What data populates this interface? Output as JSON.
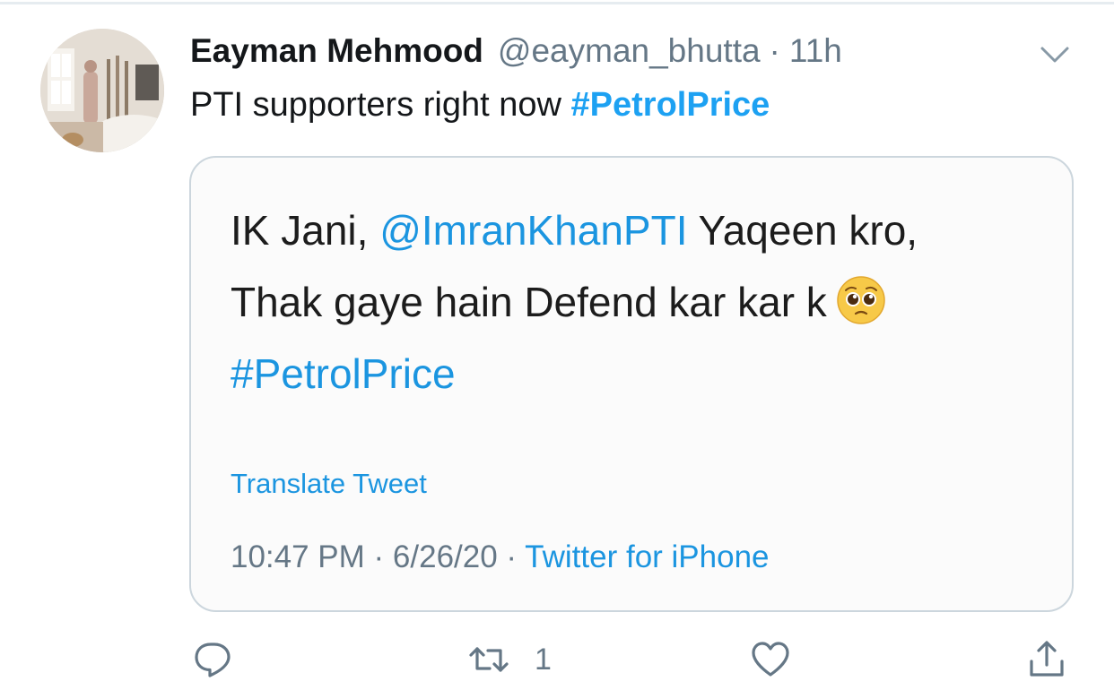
{
  "tweet": {
    "author_name": "Eayman Mehmood",
    "handle": "@eayman_bhutta",
    "separator": "·",
    "time": "11h",
    "text": "PTI supporters right now",
    "hashtag": "#PetrolPrice"
  },
  "quoted": {
    "line1_prefix": "IK Jani,",
    "mention": "@ImranKhanPTI",
    "line1_suffix": "Yaqeen kro,",
    "line2": "Thak gaye hain Defend kar kar k",
    "emoji_icon": "pleading-face-emoji",
    "hashtag": "#PetrolPrice",
    "translate_label": "Translate Tweet",
    "timestamp": "10:47 PM · 6/26/20 ·",
    "source": "Twitter for iPhone"
  },
  "actions": {
    "reply_icon": "reply-icon",
    "retweet_icon": "retweet-icon",
    "retweet_count": "1",
    "like_icon": "heart-icon",
    "share_icon": "share-icon"
  },
  "colors": {
    "accent": "#1da1f2",
    "secondary_text": "#657786",
    "border": "#ccd6dd"
  }
}
